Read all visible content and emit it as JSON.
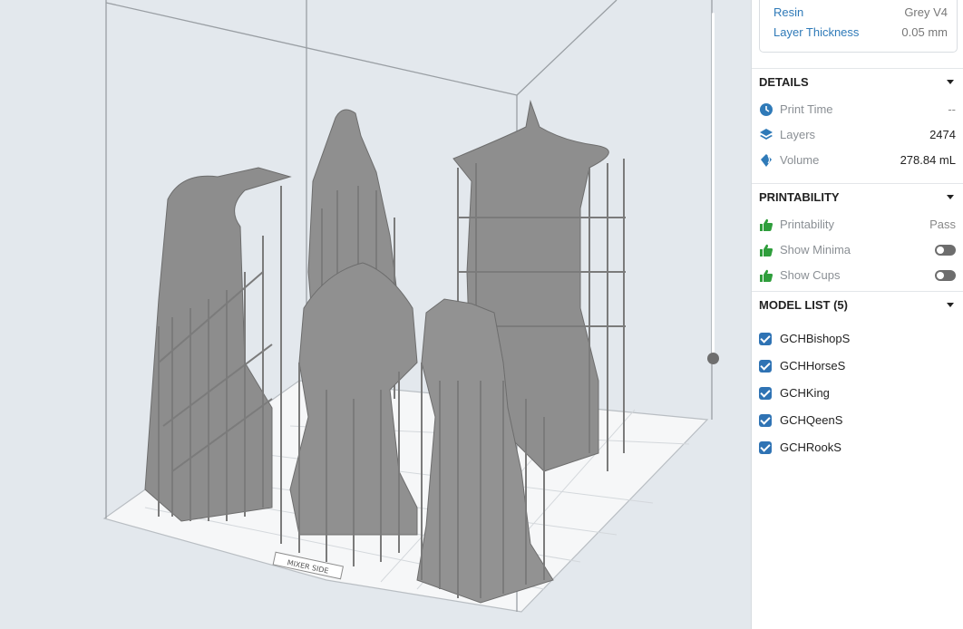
{
  "material": {
    "resin_label": "Resin",
    "resin_value": "Grey V4",
    "layer_thickness_label": "Layer Thickness",
    "layer_thickness_value": "0.05 mm"
  },
  "details": {
    "title": "DETAILS",
    "print_time_label": "Print Time",
    "print_time_value": "--",
    "layers_label": "Layers",
    "layers_value": "2474",
    "volume_label": "Volume",
    "volume_value": "278.84 mL"
  },
  "printability": {
    "title": "PRINTABILITY",
    "printability_label": "Printability",
    "printability_value": "Pass",
    "show_minima_label": "Show Minima",
    "show_minima_on": false,
    "show_cups_label": "Show Cups",
    "show_cups_on": false
  },
  "model_list": {
    "title": "MODEL LIST (5)",
    "items": [
      "GCHBishopS",
      "GCHHorseS",
      "GCHKing",
      "GCHQeenS",
      "GCHRookS"
    ],
    "checked": [
      true,
      true,
      true,
      true,
      true
    ]
  },
  "viewport": {
    "platform_label": "MIXER SIDE",
    "layer_slider_level": 1.0
  },
  "colors": {
    "accent_blue": "#2f7ab8",
    "thumb_green": "#2f9e3c",
    "model_grey": "#8d8d8d"
  },
  "icons": {
    "print_time": "clock-icon",
    "layers": "layers-icon",
    "volume": "resin-drop-icon",
    "printability": "thumbs-up-icon"
  }
}
